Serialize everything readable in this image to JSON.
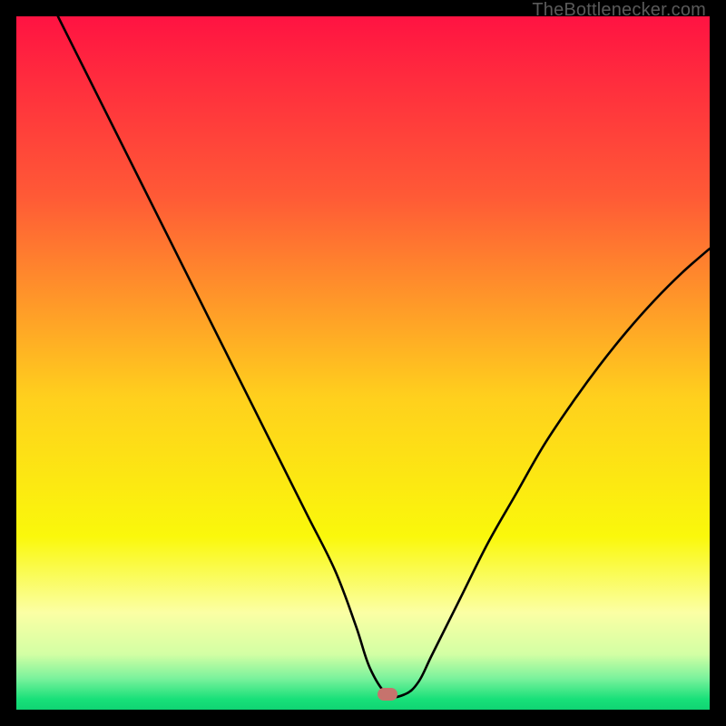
{
  "watermark": "TheBottlenecker.com",
  "chart_data": {
    "type": "line",
    "title": "",
    "xlabel": "",
    "ylabel": "",
    "xlim": [
      0,
      100
    ],
    "ylim": [
      0,
      100
    ],
    "gradient_stops": [
      {
        "offset": 0,
        "color": "#ff1342"
      },
      {
        "offset": 0.26,
        "color": "#ff5a36"
      },
      {
        "offset": 0.55,
        "color": "#ffd01d"
      },
      {
        "offset": 0.75,
        "color": "#faf80b"
      },
      {
        "offset": 0.86,
        "color": "#fbffa4"
      },
      {
        "offset": 0.92,
        "color": "#d3ffa4"
      },
      {
        "offset": 0.955,
        "color": "#7af29c"
      },
      {
        "offset": 0.985,
        "color": "#18e079"
      },
      {
        "offset": 1.0,
        "color": "#10d473"
      }
    ],
    "curve": {
      "x": [
        6,
        10,
        14,
        18,
        22,
        26,
        30,
        34,
        38,
        42,
        46,
        49,
        51,
        53.5,
        56,
        58,
        60,
        64,
        68,
        72,
        76,
        80,
        84,
        88,
        92,
        96,
        100
      ],
      "y": [
        100,
        92,
        84,
        76,
        68,
        60,
        52,
        44,
        36,
        28,
        20,
        12,
        6,
        2.2,
        2.2,
        4,
        8,
        16,
        24,
        31,
        38,
        44,
        49.5,
        54.5,
        59,
        63,
        66.5
      ]
    },
    "marker": {
      "x": 53.5,
      "y": 2.2
    }
  }
}
